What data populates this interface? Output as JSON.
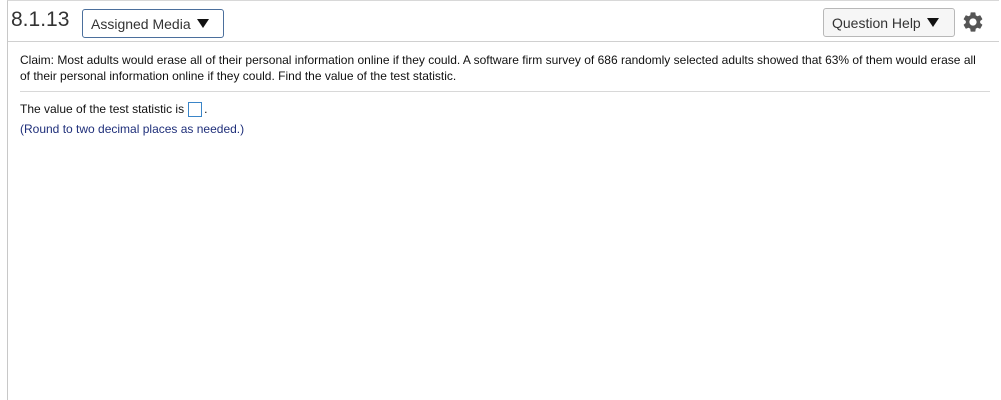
{
  "header": {
    "question_number": "8.1.13",
    "assigned_media_label": "Assigned Media",
    "question_help_label": "Question Help"
  },
  "question": {
    "claim_text": "Claim: Most adults would erase all of their personal information online if they could. A software firm survey of 686 randomly selected adults showed that 63% of them would erase all of their personal information online if they could. Find the value of the test statistic.",
    "answer_prompt": "The value of the test statistic is",
    "answer_suffix": ".",
    "answer_value": "",
    "hint_text": "(Round to two decimal places as needed.)"
  },
  "icons": {
    "media_dropdown": "caret-down-icon",
    "help_dropdown": "caret-down-icon",
    "settings": "gear-icon"
  },
  "colors": {
    "link_text": "#1f2f7a",
    "input_border": "#3a85c8",
    "media_button_border": "#4b6f9c"
  }
}
